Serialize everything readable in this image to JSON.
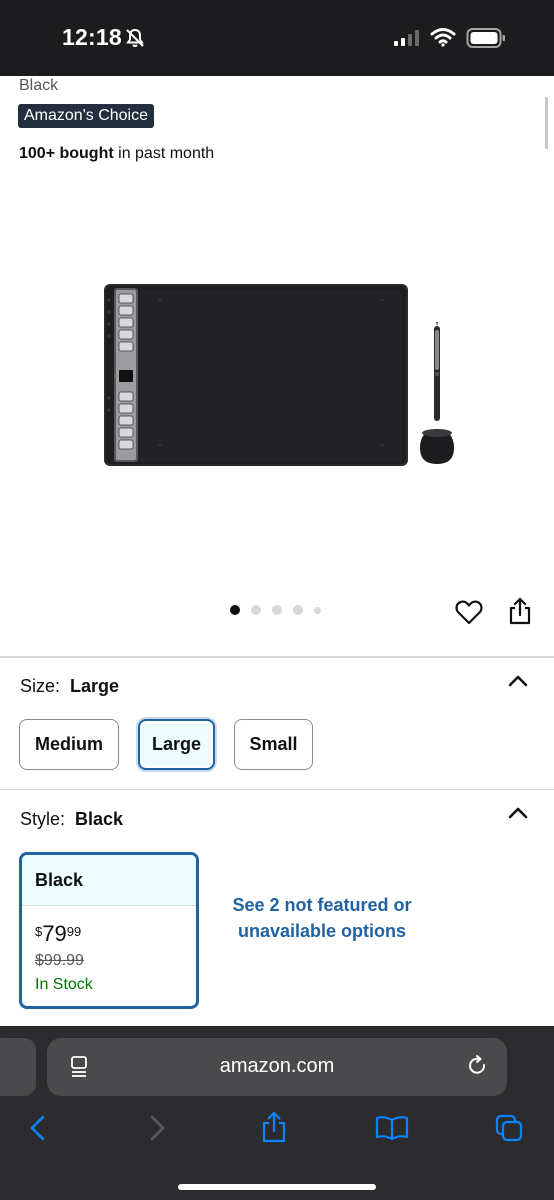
{
  "status_bar": {
    "time": "12:18",
    "icons": [
      "bell-slash-icon",
      "cellular-signal-icon",
      "wifi-icon",
      "battery-icon"
    ]
  },
  "product": {
    "color_name": "Black",
    "badge": "Amazon's Choice",
    "bought_count": "100+ bought",
    "bought_suffix": " in past month",
    "image_count": 5,
    "active_image_index": 0
  },
  "size": {
    "label": "Size:",
    "selected_value": "Large",
    "options": [
      "Medium",
      "Large",
      "Small"
    ]
  },
  "style": {
    "label": "Style:",
    "selected_value": "Black",
    "card": {
      "name": "Black",
      "currency": "$",
      "price_whole": "79",
      "price_fraction": "99",
      "list_price": "$99.99",
      "availability": "In Stock"
    },
    "more_options": "See 2 not featured or unavailable options"
  },
  "browser": {
    "url": "amazon.com",
    "toolbar": [
      "back-icon",
      "forward-icon",
      "share-icon",
      "bookmarks-icon",
      "tabs-icon"
    ]
  },
  "colors": {
    "link_blue": "#2162a1",
    "in_stock_green": "#007600",
    "badge_bg": "#232f3e",
    "browser_bg": "#2c2c2e",
    "toolbar_blue": "#0a84ff"
  }
}
